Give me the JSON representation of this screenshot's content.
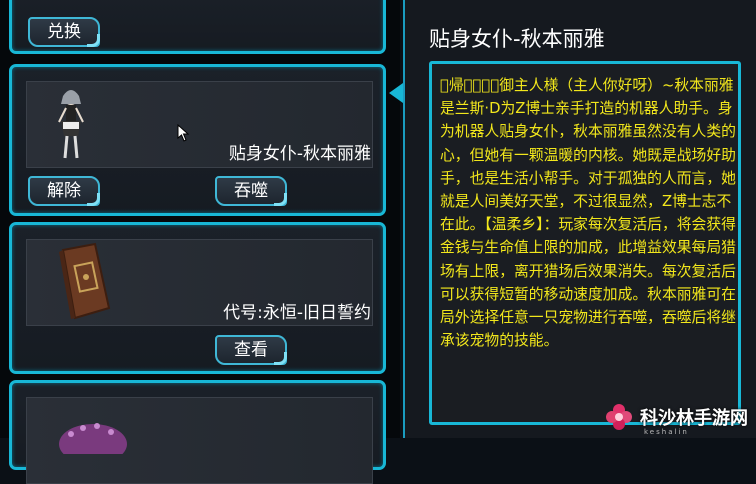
{
  "cards": [
    {
      "button_label": "兑换"
    },
    {
      "name": "贴身女仆-秋本丽雅",
      "button_left": "解除",
      "button_right": "吞噬"
    },
    {
      "name": "代号:永恒-旧日誓约",
      "button_label": "查看"
    },
    {}
  ],
  "detail": {
    "title": "贴身女仆-秋本丽雅",
    "description": "\u0000帰\u0000\u0000\u0000\u0000御主人様（主人你好呀）~秋本丽雅是兰斯·D为Z博士亲手打造的机器人助手。身为机器人贴身女仆，秋本丽雅虽然没有人类的心，但她有一颗温暖的内核。她既是战场好助手，也是生活小帮手。对于孤独的人而言，她就是人间美好天堂，不过很显然，Z博士志不在此。【温柔乡】：玩家每次复活后，将会获得金钱与生命值上限的加成，此增益效果每局猎场有上限，离开猎场后效果消失。每次复活后可以获得短暂的移动速度加成。秋本丽雅可在局外选择任意一只宠物进行吞噬，吞噬后将继承该宠物的技能。"
  },
  "watermark": {
    "text": "科沙林手游网",
    "sub": "keshalin"
  },
  "colors": {
    "accent": "#18b7d6",
    "description": "#f2e71c",
    "background": "#15191f"
  }
}
